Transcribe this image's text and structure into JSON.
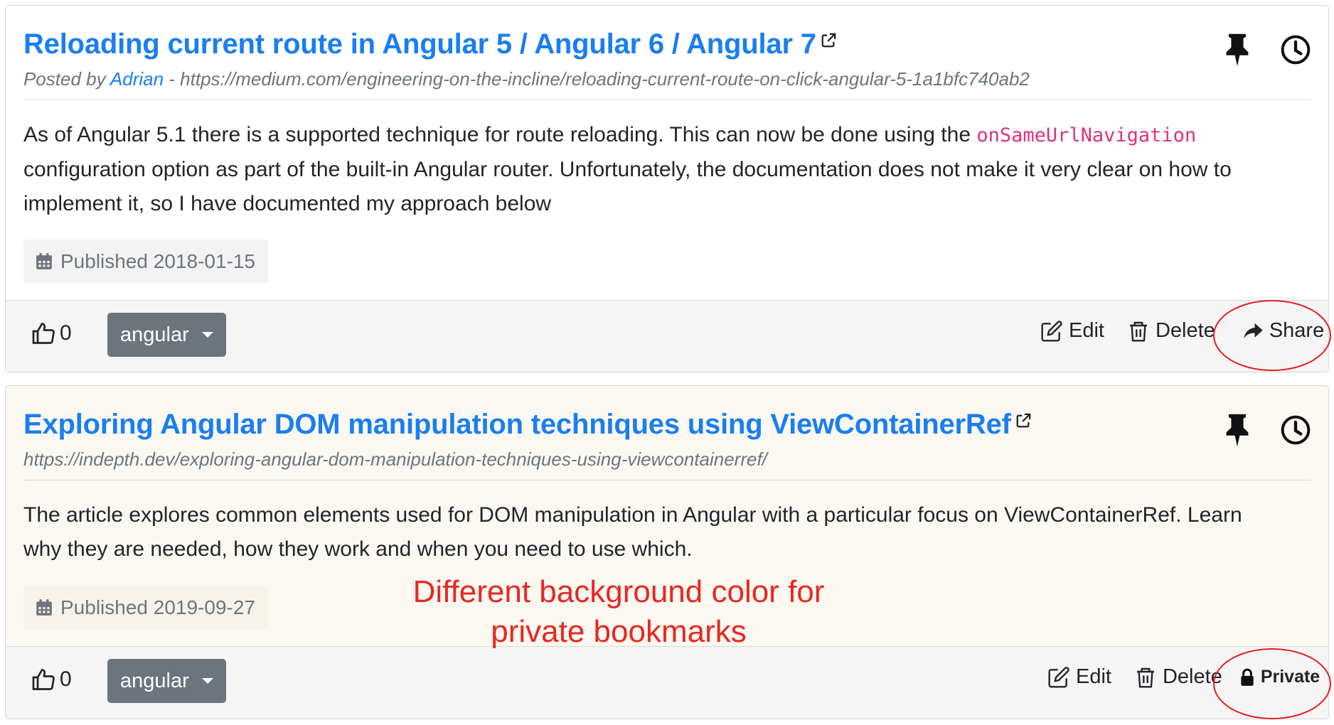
{
  "bookmarks": [
    {
      "title": "Reloading current route in Angular 5 / Angular 6 / Angular 7",
      "meta_prefix": "Posted by ",
      "author": "Adrian",
      "url_prefix": " - ",
      "url": "https://medium.com/engineering-on-the-incline/reloading-current-route-on-click-angular-5-1a1bfc740ab2",
      "description_before": "As of Angular 5.1 there is a supported technique for route reloading. This can now be done using the ",
      "code": "onSameUrlNavigation",
      "description_after": " configuration option as part of the built-in Angular router. Unfortunately, the documentation does not make it very clear on how to implement it, so I have documented my approach below",
      "published": "Published 2018-01-15",
      "likes": "0",
      "tag": "angular",
      "edit_label": "Edit",
      "delete_label": "Delete",
      "share_label": "Share"
    },
    {
      "title": "Exploring Angular DOM manipulation techniques using ViewContainerRef",
      "url": "https://indepth.dev/exploring-angular-dom-manipulation-techniques-using-viewcontainerref/",
      "description": "The article explores common elements used for DOM manipulation in Angular with a particular focus on ViewContainerRef. Learn why they are needed, how they work and when you need to use which.",
      "published": "Published 2019-09-27",
      "likes": "0",
      "tag": "angular",
      "edit_label": "Edit",
      "delete_label": "Delete",
      "private_label": "Private"
    }
  ],
  "annotation": {
    "line1": "Different background color for",
    "line2": "private bookmarks"
  },
  "colors": {
    "link": "#1a7ef0",
    "private_background": "#fbf8f1",
    "annotation": "#e82820",
    "tag_button": "#6c757d"
  }
}
